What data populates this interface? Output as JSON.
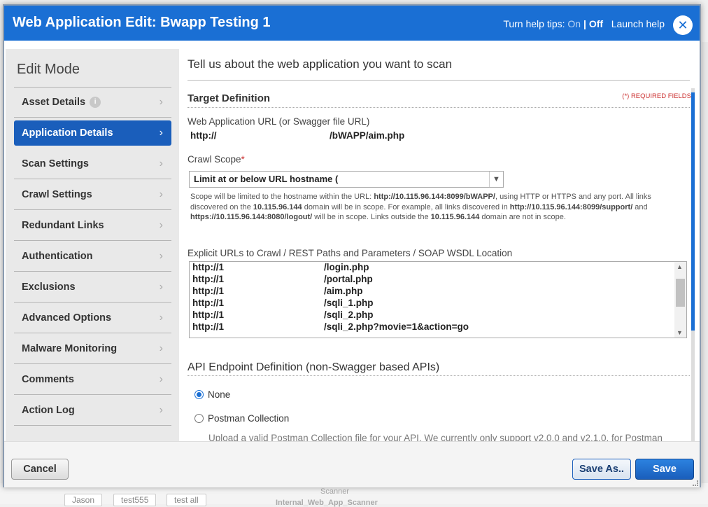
{
  "dialog": {
    "title": "Web Application Edit: Bwapp Testing 1",
    "help_prefix": "Turn help tips:",
    "help_on": "On",
    "help_sep": "|",
    "help_off": "Off",
    "launch_help": "Launch help",
    "close": "✕"
  },
  "sidebar": {
    "title": "Edit Mode",
    "items": [
      {
        "label": "Asset Details"
      },
      {
        "label": "Application Details"
      },
      {
        "label": "Scan Settings"
      },
      {
        "label": "Crawl Settings"
      },
      {
        "label": "Redundant Links"
      },
      {
        "label": "Authentication"
      },
      {
        "label": "Exclusions"
      },
      {
        "label": "Advanced Options"
      },
      {
        "label": "Malware Monitoring"
      },
      {
        "label": "Comments"
      },
      {
        "label": "Action Log"
      }
    ],
    "chevron": "›"
  },
  "main": {
    "lead": "Tell us about the web application you want to scan",
    "target_heading": "Target Definition",
    "required_note": "(*) REQUIRED FIELDS",
    "url_label": "Web Application URL (or Swagger file URL)",
    "url_prefix": "http://",
    "url_suffix": "/bWAPP/aim.php",
    "crawl_scope_label": "Crawl Scope",
    "required_star": "*",
    "crawl_scope_value": "Limit at or below URL hostname (",
    "scope_desc": {
      "p1": "Scope will be limited to the hostname within the URL: ",
      "b1": "http://10.115.96.144:8099/bWAPP/",
      "p2": ", using HTTP or HTTPS and any port. All links discovered on the ",
      "b2": "10.115.96.144",
      "p3": " domain will be in scope. For example, all links discovered in ",
      "b3": "http://10.115.96.144:8099/support/",
      "p4": " and ",
      "b4": "https://10.115.96.144:8080/logout/",
      "p5": " will be in scope. Links outside the ",
      "b5": "10.115.96.144",
      "p6": " domain are not in scope."
    },
    "explicit_label": "Explicit URLs to Crawl / REST Paths and Parameters / SOAP WSDL Location",
    "explicit_urls": [
      {
        "prefix": "http://1",
        "path": "/login.php"
      },
      {
        "prefix": "http://1",
        "path": "/portal.php"
      },
      {
        "prefix": "http://1",
        "path": "/aim.php"
      },
      {
        "prefix": "http://1",
        "path": "/sqli_1.php"
      },
      {
        "prefix": "http://1",
        "path": "/sqli_2.php"
      },
      {
        "prefix": "http://1",
        "path": "/sqli_2.php?movie=1&action=go"
      }
    ],
    "api_heading": "API Endpoint Definition (non-Swagger based APIs)",
    "api_options": [
      {
        "label": "None",
        "checked": true
      },
      {
        "label": "Postman Collection",
        "checked": false
      }
    ],
    "upload_note": "Upload a valid Postman Collection file for your API. We currently only support v2.0.0 and v2.1.0. for Postman"
  },
  "footer": {
    "cancel": "Cancel",
    "save_as": "Save As..",
    "save": "Save"
  },
  "background": {
    "chips": [
      "Jason",
      "test555",
      "test all"
    ],
    "scanner": "Scanner",
    "bottom_text": "Internal_Web_App_Scanner"
  }
}
